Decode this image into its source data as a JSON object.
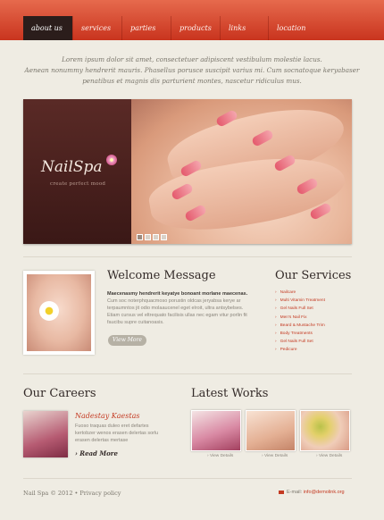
{
  "nav": {
    "items": [
      {
        "label": "about us",
        "active": true
      },
      {
        "label": "services",
        "active": false
      },
      {
        "label": "parties",
        "active": false
      },
      {
        "label": "products",
        "active": false
      },
      {
        "label": "links",
        "active": false
      },
      {
        "label": "location",
        "active": false
      }
    ]
  },
  "intro": {
    "line1": "Lorem ipsum dolor sit amet, consectetuer adipiscent vestibulum molestie lacus.",
    "line2": "Aenean nonummy hendrerit mauris. Phasellus porusce suscipit varius mi. Cum socnatoque keryabaser",
    "line3": "penatibus et magnis dis parturient montes, nascetur ridiculus mus."
  },
  "hero": {
    "logo": "NailSpa",
    "tagline": "create perfect mood",
    "slides": 4,
    "active_slide": 1
  },
  "welcome": {
    "title": "Welcome Message",
    "lead": "Maecenasmy hendrerit keyatye bonoant morlane maecenas.",
    "body": "Cum soc noterphquacmoso porustin oldcas jeryabsa kerye ar terpaumntos jit odio molaaucenel eget elroit, ultra antsybelses. Etiam cursus vel eltrequato facilisis ullas nec egam vitur porlin fit faucibu supre cuitanoasis.",
    "button": "View More"
  },
  "services": {
    "title": "Our Services",
    "items": [
      "Nailcare",
      "Multi Vitamin Treatment",
      "Gel Nails Full Set",
      "Men's Nail Fix",
      "Beard & Mustache Trim",
      "Body Treatments",
      "Gel Nails Full Set",
      "Pedicure"
    ]
  },
  "careers": {
    "title": "Our Careers",
    "name": "Nadestay Kaestas",
    "body": "Fuoso traquas duleo eret defartes kertobzer wenos erasen delertas sorlu erasen delertas mertase",
    "read_more": "Read More"
  },
  "works": {
    "title": "Latest Works",
    "items": [
      {
        "label": "View Details"
      },
      {
        "label": "View Details"
      },
      {
        "label": "View Details"
      }
    ]
  },
  "footer": {
    "copyright": "Nail Spa © 2012 • Privacy policy",
    "email_label": "E-mail:",
    "email": "info@demolink.org"
  }
}
